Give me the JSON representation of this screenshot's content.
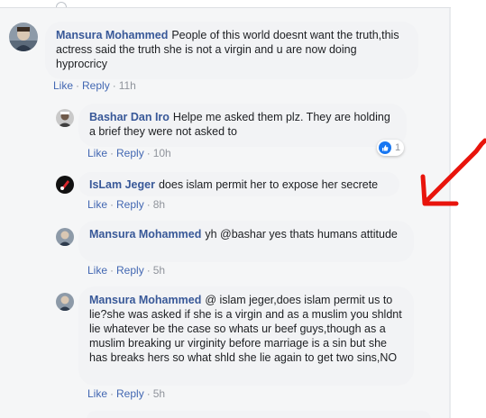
{
  "colors": {
    "author": "#385898",
    "action_link": "#4267b2",
    "meta": "#90949c",
    "bubble": "#f2f3f5",
    "arrow": "#e8140c"
  },
  "comments": [
    {
      "author": "Mansura Mohammed",
      "text": "People of this world doesnt want the truth,this actress said the truth she is not a virgin and u are now doing hyprocricy",
      "like": "Like",
      "reply": "Reply",
      "time": "11h",
      "avatar_icon": "user-avatar-icon"
    },
    {
      "author": "Bashar Dan Iro",
      "text": "Helpe me asked them plz. They are holding a brief they were not asked to",
      "like": "Like",
      "reply": "Reply",
      "time": "10h",
      "reaction_icon": "like-reaction-icon",
      "reaction_count": "1",
      "avatar_icon": "user-avatar-icon"
    },
    {
      "author": "IsLam Jeger",
      "text": "does islam permit her to expose her secrete",
      "like": "Like",
      "reply": "Reply",
      "time": "8h",
      "avatar_icon": "user-avatar-icon"
    },
    {
      "author": "Mansura Mohammed",
      "text": "yh @bashar yes thats humans attitude",
      "like": "Like",
      "reply": "Reply",
      "time": "5h",
      "avatar_icon": "user-avatar-icon"
    },
    {
      "author": "Mansura Mohammed",
      "text": "@ islam jeger,does islam permit us to lie?she was asked if she is a virgin and as a muslim you shldnt lie whatever be the case so whats ur beef guys,though as a muslim breaking ur virginity before marriage is a sin but she has breaks hers so what shld she lie again to get two sins,NO",
      "like": "Like",
      "reply": "Reply",
      "time": "5h",
      "avatar_icon": "user-avatar-icon"
    }
  ],
  "annotation_icon": "red-arrow-icon"
}
